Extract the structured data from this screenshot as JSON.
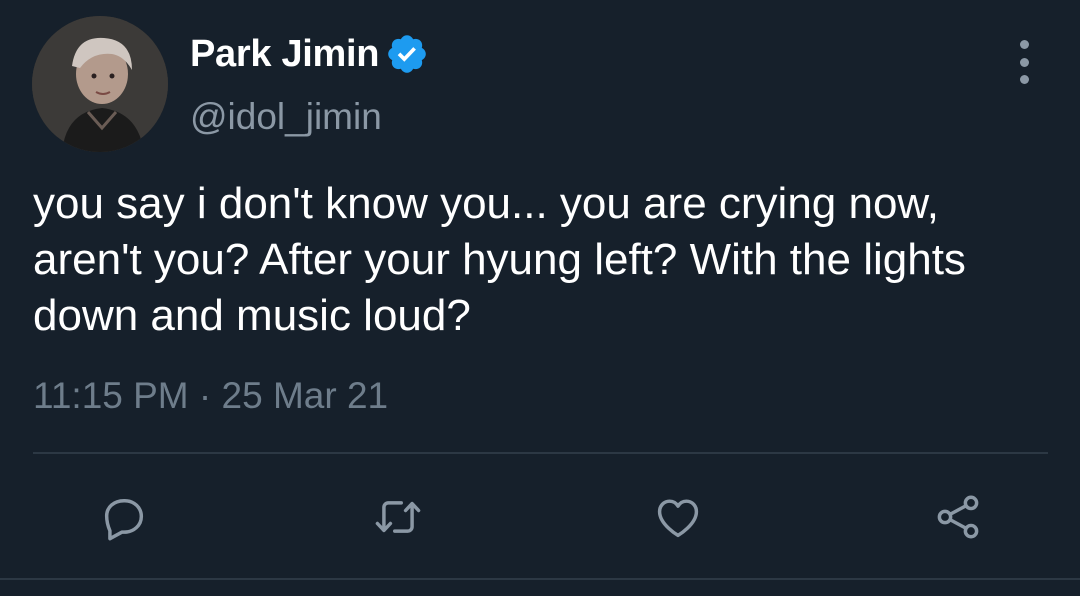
{
  "author": {
    "display_name": "Park Jimin",
    "handle": "@idol_jimin",
    "verified": true
  },
  "tweet": {
    "text": "you say i don't know you... you are crying now, aren't you? After your hyung left? With the lights down and music loud?",
    "timestamp": "11:15 PM · 25 Mar 21"
  },
  "actions": [
    {
      "icon": "reply-icon"
    },
    {
      "icon": "retweet-icon"
    },
    {
      "icon": "like-icon"
    },
    {
      "icon": "share-icon"
    }
  ],
  "colors": {
    "background": "#16202b",
    "primary_text": "#ffffff",
    "secondary_text": "#8b98a5",
    "verified_badge": "#1d9bf0",
    "divider": "#2c3844"
  }
}
